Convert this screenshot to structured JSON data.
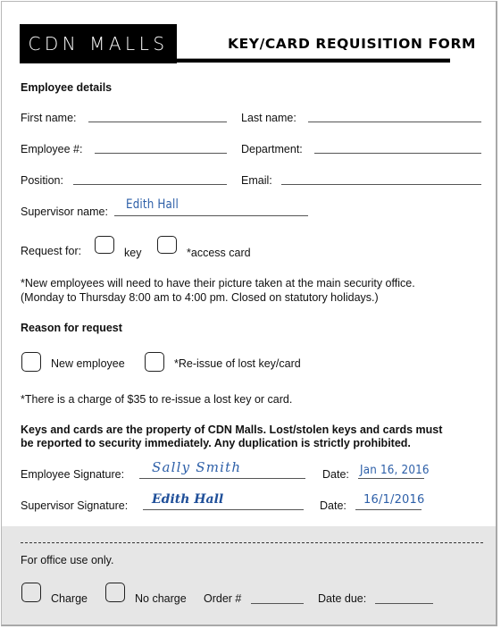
{
  "header": {
    "brand": "CDN MALLS",
    "title": "KEY/CARD REQUISITION FORM"
  },
  "employee_details": {
    "heading": "Employee details",
    "first_name": {
      "label": "First name:",
      "value": ""
    },
    "last_name": {
      "label": "Last name:",
      "value": ""
    },
    "employee_number": {
      "label": "Employee #:",
      "value": ""
    },
    "department": {
      "label": "Department:",
      "value": ""
    },
    "position": {
      "label": "Position:",
      "value": ""
    },
    "email": {
      "label": "Email:",
      "value": ""
    },
    "supervisor_name": {
      "label": "Supervisor name:",
      "value": "Edith Hall"
    }
  },
  "request_for": {
    "label": "Request for:",
    "options": [
      {
        "label": "key",
        "checked": false
      },
      {
        "label": "*access card",
        "checked": false
      }
    ]
  },
  "notes": {
    "new_employee_line1": "*New employees will need to have their picture taken at the main security office.",
    "new_employee_line2": "(Monday to Thursday 8:00 am to 4:00 pm. Closed on statutory holidays.)",
    "charge": "*There is a charge of $35 to re-issue a lost key or card.",
    "property_line1": "Keys and cards are the property of CDN Malls. Lost/stolen keys and cards must",
    "property_line2": "be reported to security immediately. Any duplication is strictly prohibited."
  },
  "reason": {
    "heading": "Reason for request",
    "options": [
      {
        "label": "New employee",
        "checked": false
      },
      {
        "label": "*Re-issue of lost key/card",
        "checked": false
      }
    ]
  },
  "signatures": {
    "employee": {
      "label": "Employee Signature:",
      "value": "Sally Smith",
      "date_label": "Date:",
      "date": "Jan 16, 2016"
    },
    "supervisor": {
      "label": "Supervisor Signature:",
      "value": "Edith Hall",
      "date_label": "Date:",
      "date": "16/1/2016"
    }
  },
  "office_use": {
    "label": "For office use only.",
    "charge_label": "Charge",
    "no_charge_label": "No charge",
    "order_label": "Order #",
    "order_value": "",
    "date_due_label": "Date due:",
    "date_due_value": ""
  }
}
